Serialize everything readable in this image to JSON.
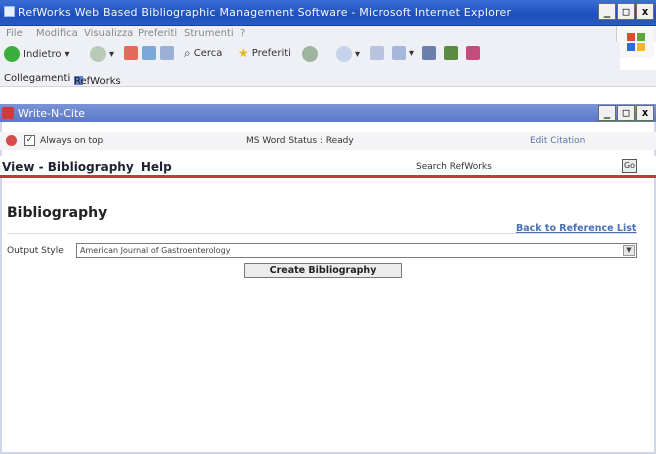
{
  "ie_window": {
    "title": "RefWorks Web Based Bibliographic Management Software - Microsoft Internet Explorer",
    "controls": [
      "_",
      "□",
      "x"
    ]
  },
  "menu": [
    "File",
    "Modifica",
    "Visualizza",
    "Preferiti",
    "Strumenti",
    "?"
  ],
  "toolbar": {
    "back_label": "Indietro",
    "search_label": "Cerca",
    "favorites_label": "Preferiti"
  },
  "links_bar": {
    "label": "Collegamenti",
    "item": "RefWorks"
  },
  "wnc_window": {
    "title": "Write-N-Cite",
    "controls": [
      "_",
      "□",
      "x"
    ]
  },
  "status_bar": {
    "always_on_top": "Always on top",
    "ms_word_status": "MS Word Status : Ready",
    "edit_citation": "Edit Citation"
  },
  "nav": {
    "view": "View",
    "bibliography": "Bibliography",
    "help": "Help",
    "search_label": "Search RefWorks",
    "search_value": "",
    "go": "Go"
  },
  "main": {
    "title": "Bibliography",
    "back_link": "Back to Reference List",
    "output_style_label": "Output Style",
    "output_style_value": "American Journal of Gastroenterology",
    "create_button": "Create Bibliography"
  },
  "colors": {
    "ie_titlebar": "#2a5bc4",
    "wnc_titlebar": "#6b86d0",
    "nav_underline": "#c23b3b",
    "link": "#4a6fb6"
  }
}
